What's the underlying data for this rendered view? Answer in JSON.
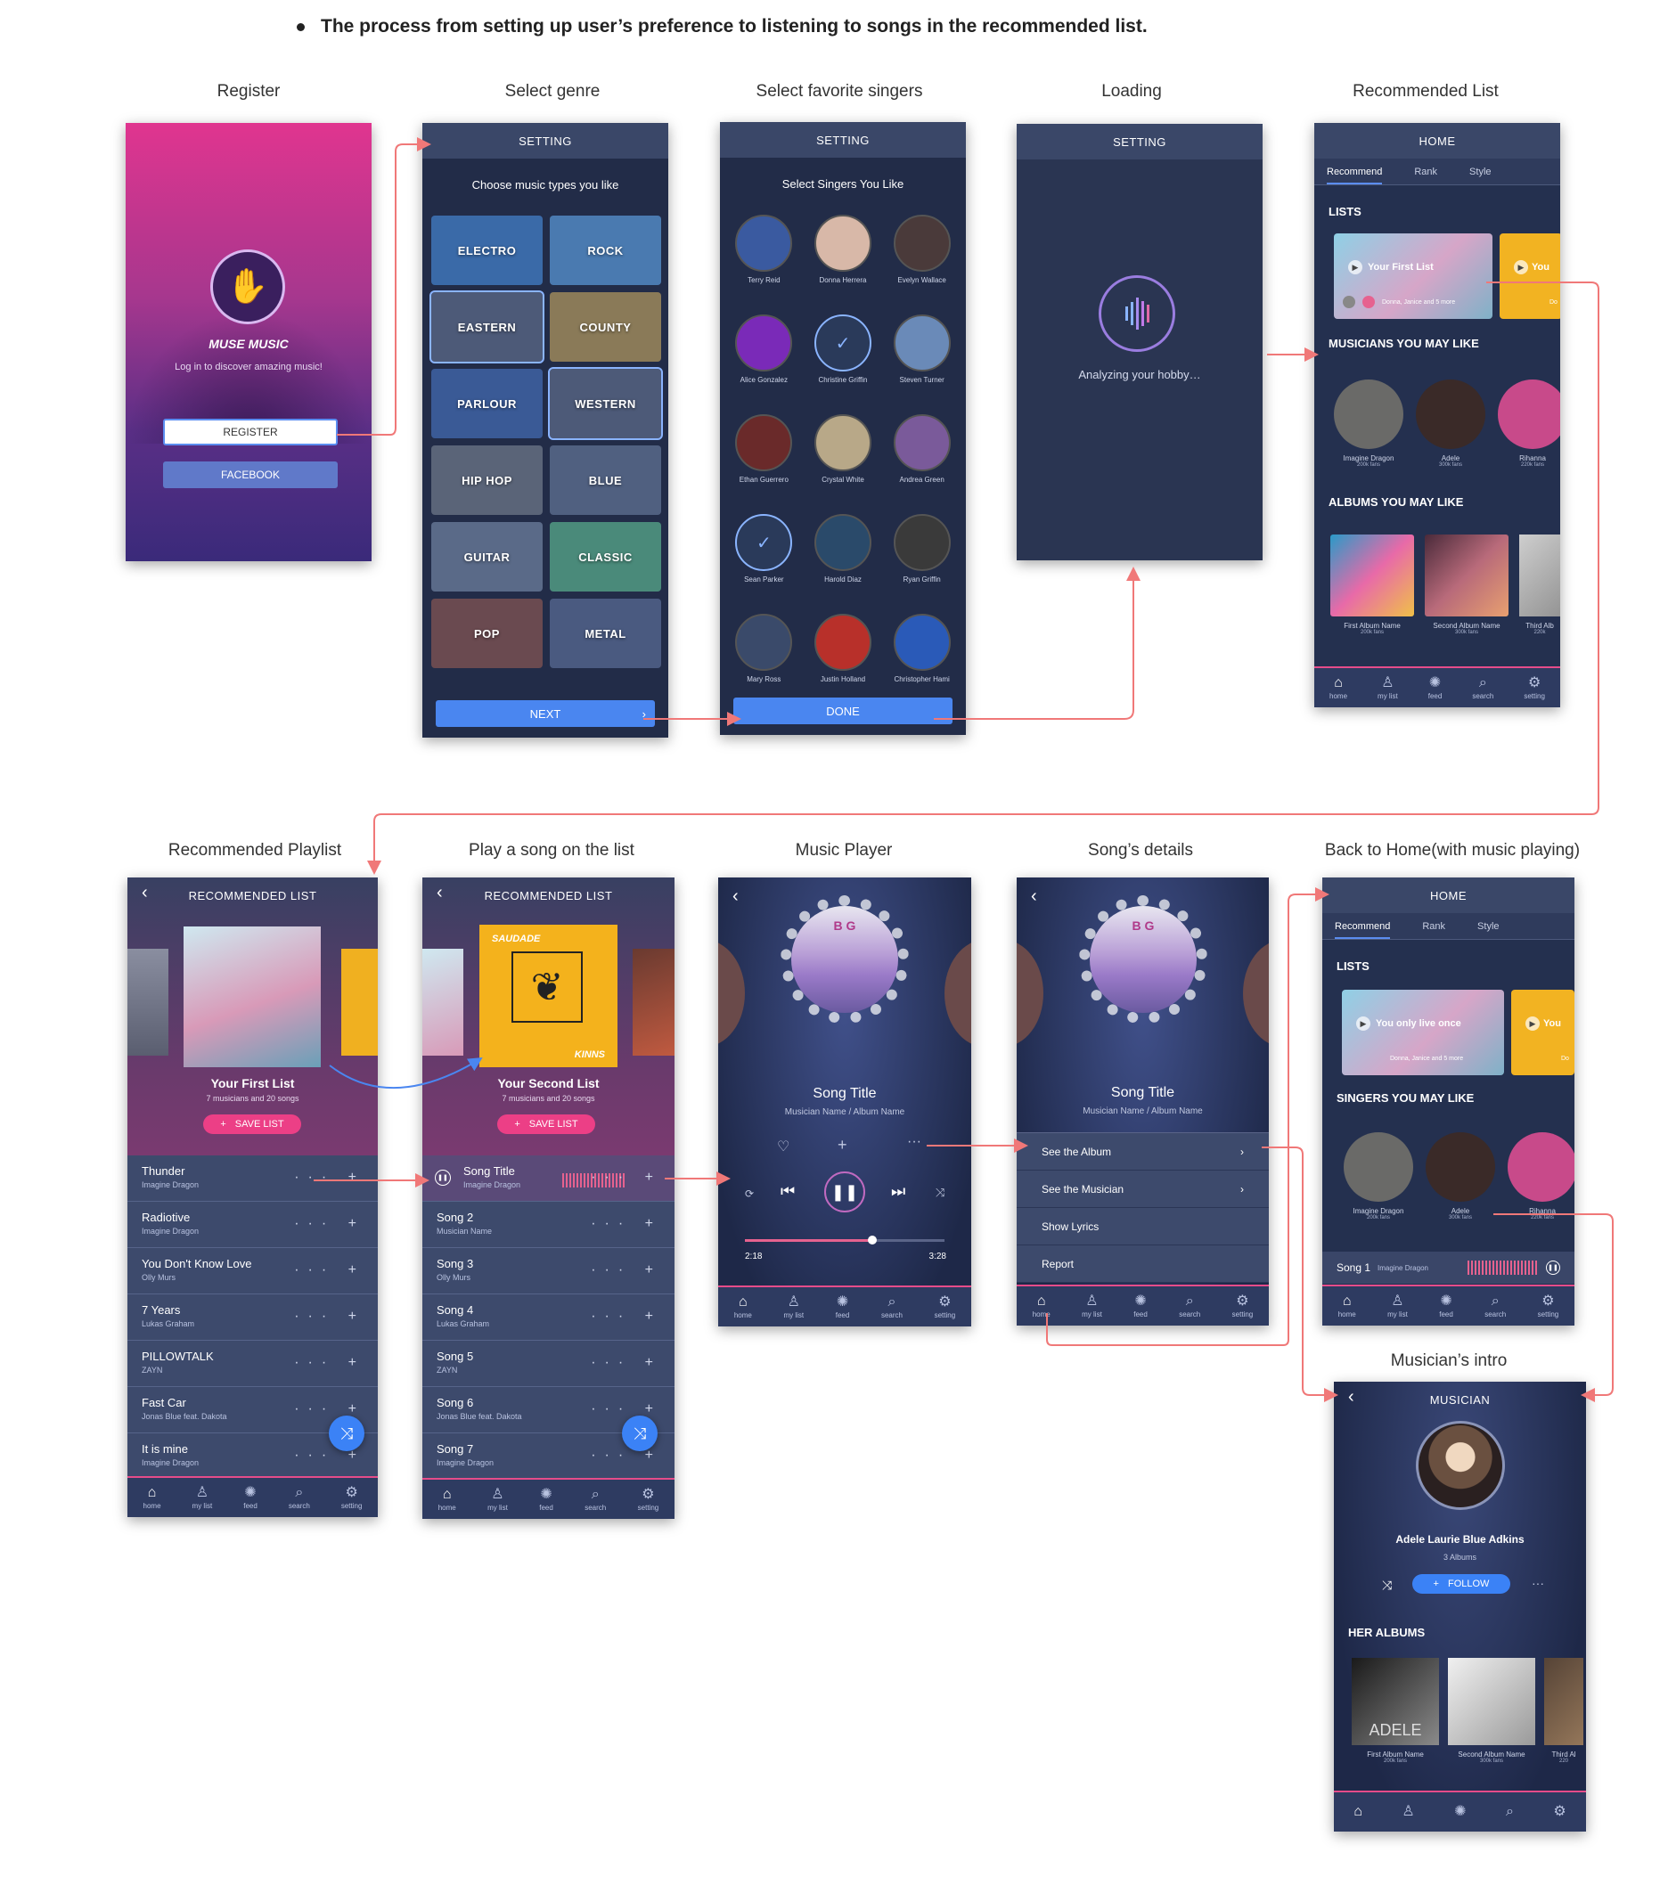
{
  "headline": "The process from setting up user’s preference to listening to songs in the recommended list.",
  "steps": {
    "register": "Register",
    "genre": "Select genre",
    "singers": "Select favorite singers",
    "loading": "Loading",
    "rec_list": "Recommended List",
    "rec_playlist": "Recommended Playlist",
    "play_song": "Play a song on the list",
    "player": "Music Player",
    "details": "Song’s details",
    "back_home": "Back to Home(with music playing)",
    "intro": "Musician’s intro"
  },
  "register": {
    "app_name": "MUSE MUSIC",
    "tagline": "Log in to discover amazing music!",
    "register_btn": "REGISTER",
    "facebook_btn": "FACEBOOK"
  },
  "genre": {
    "header": "SETTING",
    "prompt": "Choose music types you like",
    "genres": [
      "ELECTRO",
      "ROCK",
      "EASTERN",
      "COUNTY",
      "PARLOUR",
      "WESTERN",
      "HIP HOP",
      "BLUE",
      "GUITAR",
      "CLASSIC",
      "POP",
      "METAL"
    ],
    "next_btn": "NEXT"
  },
  "singers": {
    "header": "SETTING",
    "prompt": "Select Singers You Like",
    "names": [
      "Terry Reid",
      "Donna Herrera",
      "Evelyn Wallace",
      "Alice Gonzalez",
      "Christine Griffin",
      "Steven Turner",
      "Ethan Guerrero",
      "Crystal White",
      "Andrea Green",
      "Sean Parker",
      "Harold Diaz",
      "Ryan Griffin",
      "Mary Ross",
      "Justin Holland",
      "Christopher Hami"
    ],
    "done_btn": "DONE"
  },
  "loading": {
    "header": "SETTING",
    "text": "Analyzing your hobby…"
  },
  "home": {
    "header": "HOME",
    "tabs": [
      "Recommend",
      "Rank",
      "Style"
    ],
    "lists_title": "LISTS",
    "list1": "Your First List",
    "list1_alt": "You only live once",
    "list_people": "Donna, Janice and 5 more",
    "list2": "You",
    "list2_sub": "Do",
    "musicians_title": "MUSICIANS YOU MAY LIKE",
    "singers_title": "SINGERS YOU MAY LIKE",
    "musicians": [
      {
        "name": "Imagine Dragon",
        "fans": "200k fans"
      },
      {
        "name": "Adele",
        "fans": "300k fans"
      },
      {
        "name": "Rihanna",
        "fans": "220k fans"
      }
    ],
    "albums_title": "ALBUMS YOU MAY LIKE",
    "albums": [
      {
        "name": "First Album Name",
        "fans": "200k fans"
      },
      {
        "name": "Second Album Name",
        "fans": "300k fans"
      },
      {
        "name": "Third Alb",
        "fans": "220k"
      }
    ],
    "mini_song": "Song 1",
    "mini_artist": "Imagine Dragon"
  },
  "nav": [
    {
      "label": "home",
      "g": "⌂"
    },
    {
      "label": "my list",
      "g": "♙"
    },
    {
      "label": "feed",
      "g": "✺"
    },
    {
      "label": "search",
      "g": "⌕"
    },
    {
      "label": "setting",
      "g": "⚙"
    }
  ],
  "playlist": {
    "header": "RECOMMENDED LIST",
    "name1": "Your First List",
    "name2": "Your Second List",
    "meta": "7 musicians and  20 songs",
    "save": "SAVE LIST",
    "saudade": "SAUDADE",
    "kinns": "KINNS",
    "songs": [
      {
        "t": "Thunder",
        "s": "Imagine Dragon"
      },
      {
        "t": "Radiotive",
        "s": "Imagine Dragon"
      },
      {
        "t": "You Don't Know Love",
        "s": "Olly Murs"
      },
      {
        "t": "7 Years",
        "s": "Lukas Graham"
      },
      {
        "t": "PILLOWTALK",
        "s": "ZAYN"
      },
      {
        "t": "Fast Car",
        "s": "Jonas Blue feat. Dakota"
      },
      {
        "t": "It is mine",
        "s": "Imagine Dragon"
      }
    ],
    "songs2": [
      {
        "t": "Song Title",
        "s": "Imagine Dragon"
      },
      {
        "t": "Song 2",
        "s": "Musician Name"
      },
      {
        "t": "Song 3",
        "s": "Olly Murs"
      },
      {
        "t": "Song 4",
        "s": "Lukas Graham"
      },
      {
        "t": "Song 5",
        "s": "ZAYN"
      },
      {
        "t": "Song 6",
        "s": "Jonas Blue feat. Dakota"
      },
      {
        "t": "Song 7",
        "s": "Imagine Dragon"
      }
    ]
  },
  "player": {
    "title": "Song Title",
    "sub": "Musician Name / Album Name",
    "elapsed": "2:18",
    "total": "3:28",
    "progress": 0.64,
    "letters": "B G"
  },
  "details": {
    "menu": [
      "See the Album",
      "See the Musician",
      "Show Lyrics",
      "Report"
    ]
  },
  "musician": {
    "header": "MUSICIAN",
    "name": "Adele  Laurie Blue Adkins",
    "albums_count": "3 Albums",
    "follow": "FOLLOW",
    "her_albums": "HER ALBUMS",
    "albums": [
      {
        "name": "First Album Name",
        "fans": "200k fans"
      },
      {
        "name": "Second Album Name",
        "fans": "300k fans"
      },
      {
        "name": "Third Al",
        "fans": "220"
      }
    ],
    "adele_cover": "ADELE"
  }
}
